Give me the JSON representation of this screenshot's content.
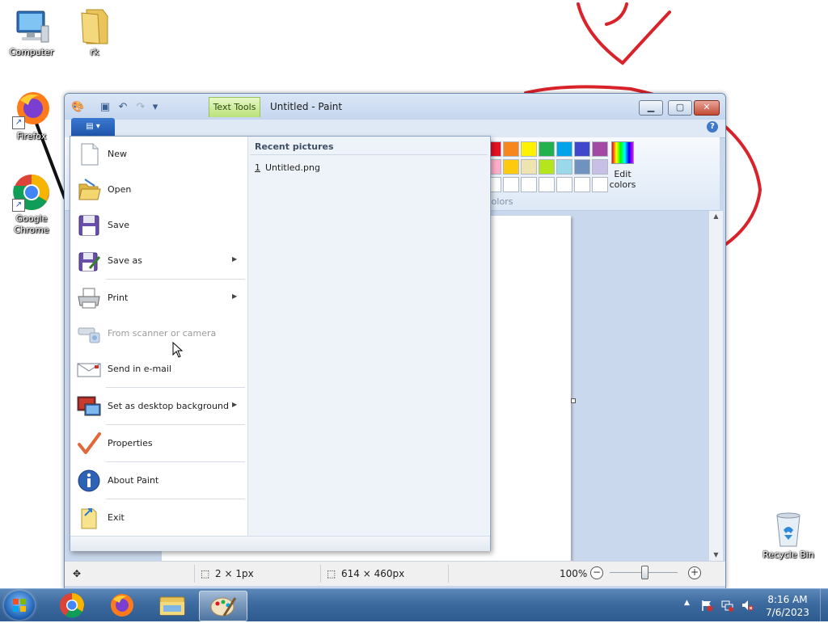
{
  "desktop": {
    "icons": [
      {
        "label": "Computer"
      },
      {
        "label": "rk"
      },
      {
        "label": "Firefox"
      },
      {
        "label": "Google Chrome"
      },
      {
        "label": "Recycle Bin"
      }
    ]
  },
  "window": {
    "title": "Untitled - Paint",
    "contextual_tab": "Text Tools",
    "help_glyph": "?",
    "minimize_glyph": "▁",
    "maximize_glyph": "▢",
    "close_glyph": "✕"
  },
  "ribbon": {
    "colors_group_label": "Colors",
    "edit_colors_label": "Edit colors",
    "palette_row1": [
      "#e81123",
      "#f7861d",
      "#fff200",
      "#22b14c",
      "#00a2e8",
      "#3f48cc",
      "#a349a4"
    ],
    "palette_row2": [
      "#ffaec9",
      "#ffc90e",
      "#efe4b0",
      "#b5e61d",
      "#99d9ea",
      "#7092be",
      "#c8bfe7"
    ],
    "palette_row3": [
      "#ffffff",
      "#ffffff",
      "#ffffff",
      "#ffffff",
      "#ffffff",
      "#ffffff",
      "#ffffff"
    ]
  },
  "file_menu": {
    "button_glyph": "▤ ▾",
    "items": [
      {
        "label": "New",
        "icon": "new-file-icon",
        "submenu": false,
        "enabled": true
      },
      {
        "label": "Open",
        "icon": "open-folder-icon",
        "submenu": false,
        "enabled": true
      },
      {
        "label": "Save",
        "icon": "floppy-disk-icon",
        "submenu": false,
        "enabled": true
      },
      {
        "label": "Save as",
        "icon": "save-as-icon",
        "submenu": true,
        "enabled": true
      },
      {
        "label": "Print",
        "icon": "printer-icon",
        "submenu": true,
        "enabled": true
      },
      {
        "label": "From scanner or camera",
        "icon": "scanner-icon",
        "submenu": false,
        "enabled": false
      },
      {
        "label": "Send in e-mail",
        "icon": "email-icon",
        "submenu": false,
        "enabled": true
      },
      {
        "label": "Set as desktop background",
        "icon": "desktop-background-icon",
        "submenu": true,
        "enabled": true
      },
      {
        "label": "Properties",
        "icon": "checkmark-icon",
        "submenu": false,
        "enabled": true
      },
      {
        "label": "About Paint",
        "icon": "info-icon",
        "submenu": false,
        "enabled": true
      },
      {
        "label": "Exit",
        "icon": "exit-icon",
        "submenu": false,
        "enabled": true
      }
    ],
    "submenu_arrow": "▶",
    "recent_title": "Recent pictures",
    "recent_items": [
      {
        "num": "1",
        "name": "Untitled.png"
      }
    ]
  },
  "statusbar": {
    "selection_size": "2 × 1px",
    "image_size": "614 × 460px",
    "zoom": "100%",
    "zoom_minus": "−",
    "zoom_plus": "+"
  },
  "taskbar": {
    "time": "8:16 AM",
    "date": "7/6/2023",
    "tray_up": "▲",
    "apps": [
      "chrome",
      "firefox",
      "file-explorer",
      "paint"
    ],
    "active_app": "paint"
  }
}
